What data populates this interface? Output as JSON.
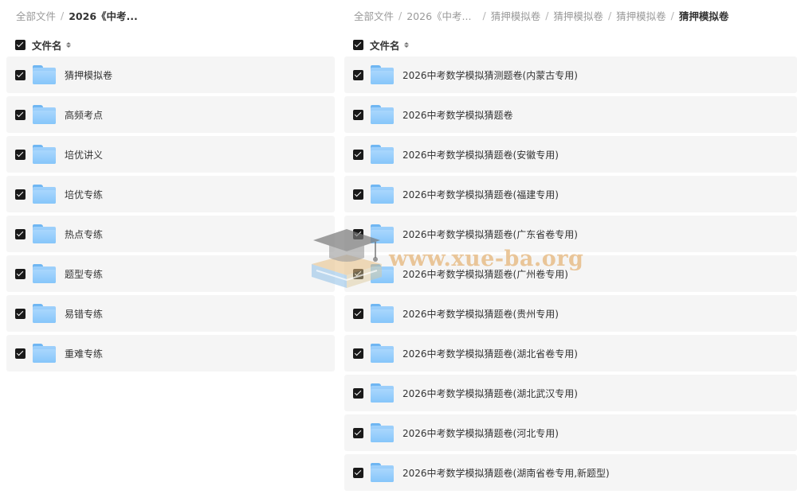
{
  "left": {
    "breadcrumb": [
      {
        "label": "全部文件"
      },
      {
        "label": "2026《中考..."
      }
    ],
    "header": {
      "label": "文件名"
    },
    "rows": [
      {
        "name": "猜押模拟卷"
      },
      {
        "name": "高频考点"
      },
      {
        "name": "培优讲义"
      },
      {
        "name": "培优专练"
      },
      {
        "name": "热点专练"
      },
      {
        "name": "题型专练"
      },
      {
        "name": "易错专练"
      },
      {
        "name": "重难专练"
      }
    ]
  },
  "right": {
    "breadcrumb": [
      {
        "label": "全部文件"
      },
      {
        "label": "2026《中考..."
      },
      {
        "label": "猜押模拟卷"
      },
      {
        "label": "猜押模拟卷"
      },
      {
        "label": "猜押模拟卷"
      },
      {
        "label": "猜押模拟卷"
      }
    ],
    "header": {
      "label": "文件名"
    },
    "rows": [
      {
        "name": "2026中考数学模拟猜测题卷(内蒙古专用)"
      },
      {
        "name": "2026中考数学模拟猜题卷"
      },
      {
        "name": "2026中考数学模拟猜题卷(安徽专用)"
      },
      {
        "name": "2026中考数学模拟猜题卷(福建专用)"
      },
      {
        "name": "2026中考数学模拟猜题卷(广东省卷专用)"
      },
      {
        "name": "2026中考数学模拟猜题卷(广州卷专用)"
      },
      {
        "name": "2026中考数学模拟猜题卷(贵州专用)"
      },
      {
        "name": "2026中考数学模拟猜题卷(湖北省卷专用)"
      },
      {
        "name": "2026中考数学模拟猜题卷(湖北武汉专用)"
      },
      {
        "name": "2026中考数学模拟猜题卷(河北专用)"
      },
      {
        "name": "2026中考数学模拟猜题卷(湖南省卷专用,新题型)"
      }
    ]
  },
  "watermark": {
    "text": "www.xue-ba.org"
  },
  "colors": {
    "folder": "#86c6fa",
    "row_bg": "#f5f5f5",
    "checkbox": "#1a1a1a"
  }
}
